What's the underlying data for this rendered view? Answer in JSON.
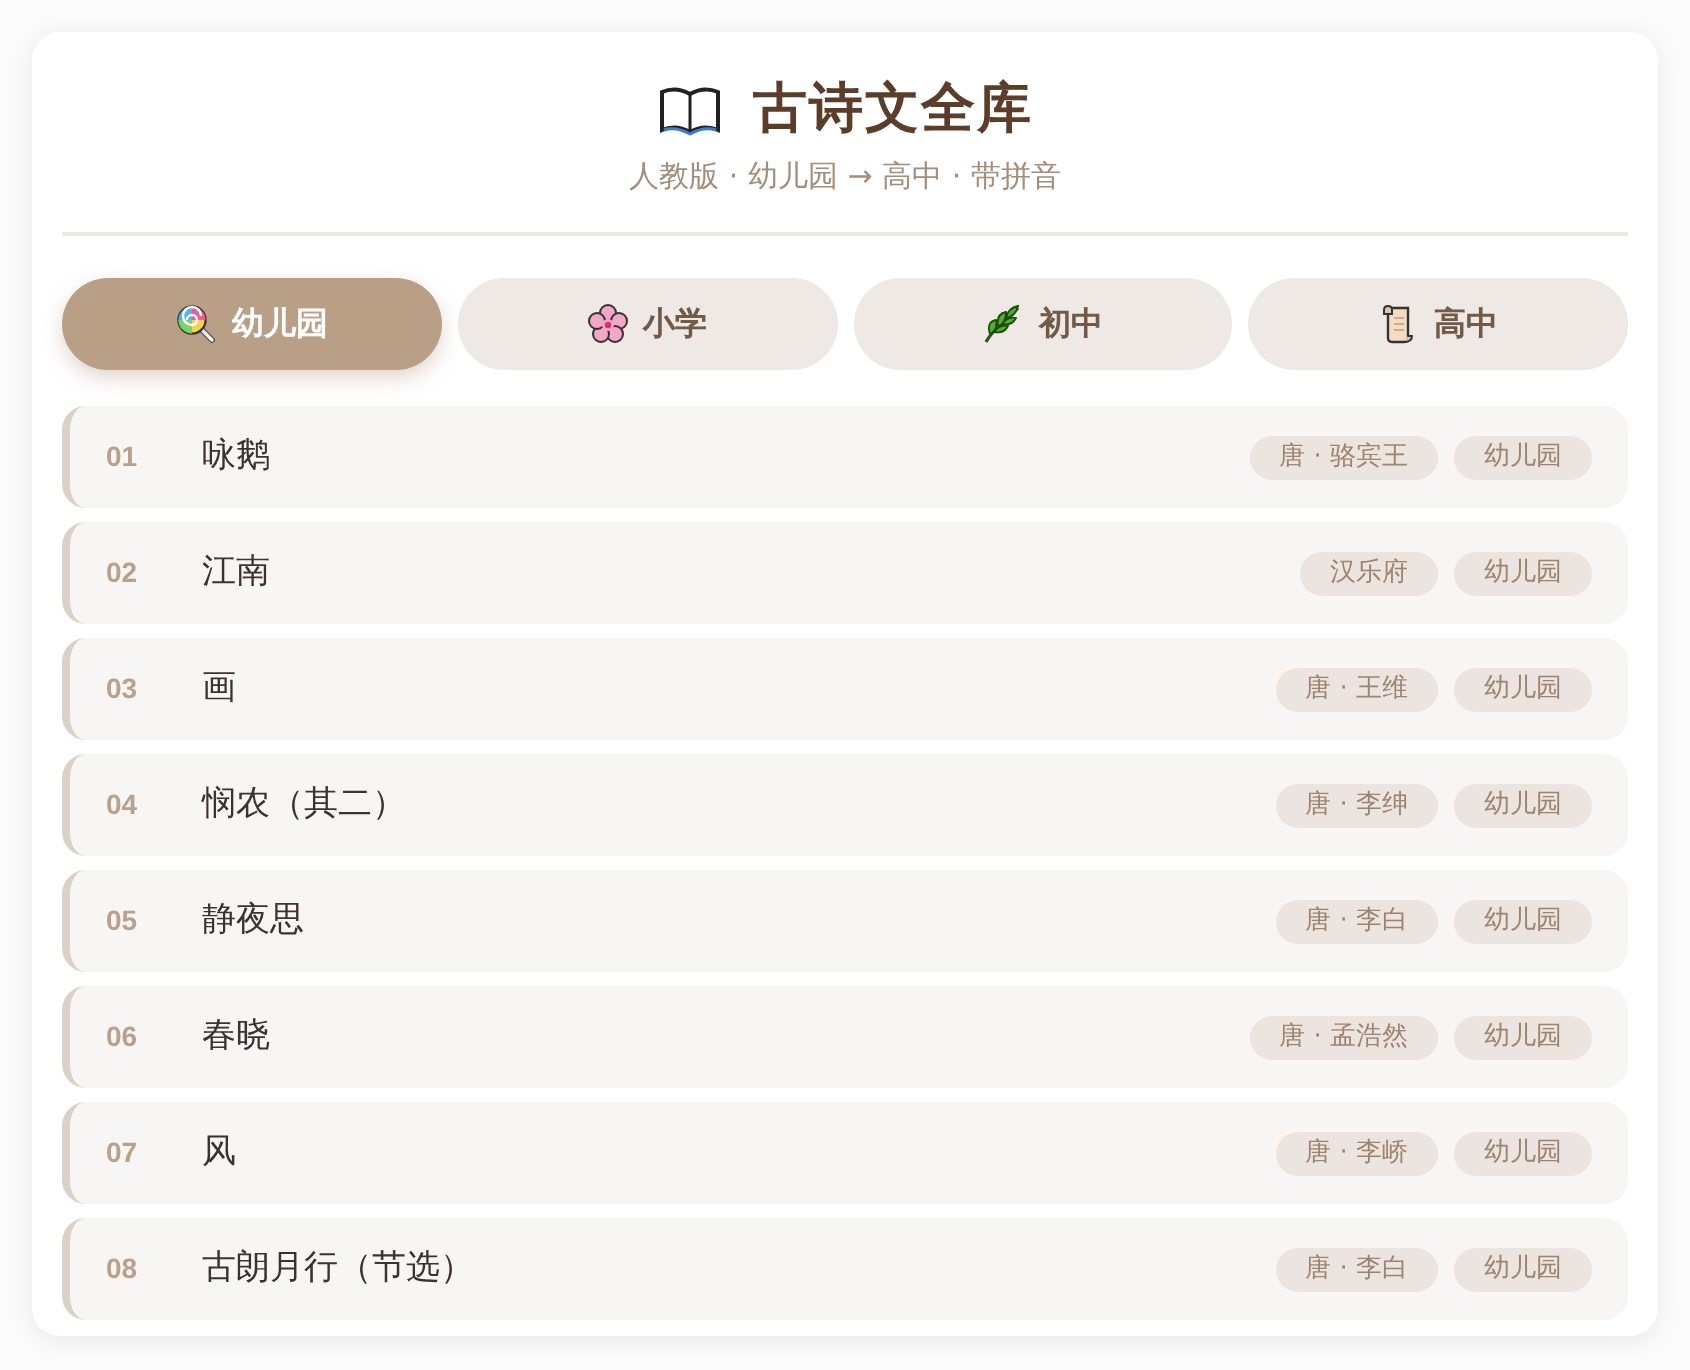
{
  "header": {
    "title": "古诗文全库",
    "subtitle": "人教版 · 幼儿园 → 高中 · 带拼音"
  },
  "tabs": [
    {
      "label": "幼儿园",
      "selected": true
    },
    {
      "label": "小学",
      "selected": false
    },
    {
      "label": "初中",
      "selected": false
    },
    {
      "label": "高中",
      "selected": false
    }
  ],
  "poems": [
    {
      "number": "01",
      "title": "咏鹅",
      "author": "唐 · 骆宾王",
      "level": "幼儿园"
    },
    {
      "number": "02",
      "title": "江南",
      "author": "汉乐府",
      "level": "幼儿园"
    },
    {
      "number": "03",
      "title": "画",
      "author": "唐 · 王维",
      "level": "幼儿园"
    },
    {
      "number": "04",
      "title": "悯农（其二）",
      "author": "唐 · 李绅",
      "level": "幼儿园"
    },
    {
      "number": "05",
      "title": "静夜思",
      "author": "唐 · 李白",
      "level": "幼儿园"
    },
    {
      "number": "06",
      "title": "春晓",
      "author": "唐 · 孟浩然",
      "level": "幼儿园"
    },
    {
      "number": "07",
      "title": "风",
      "author": "唐 · 李峤",
      "level": "幼儿园"
    },
    {
      "number": "08",
      "title": "古朗月行（节选）",
      "author": "唐 · 李白",
      "level": "幼儿园"
    }
  ]
}
